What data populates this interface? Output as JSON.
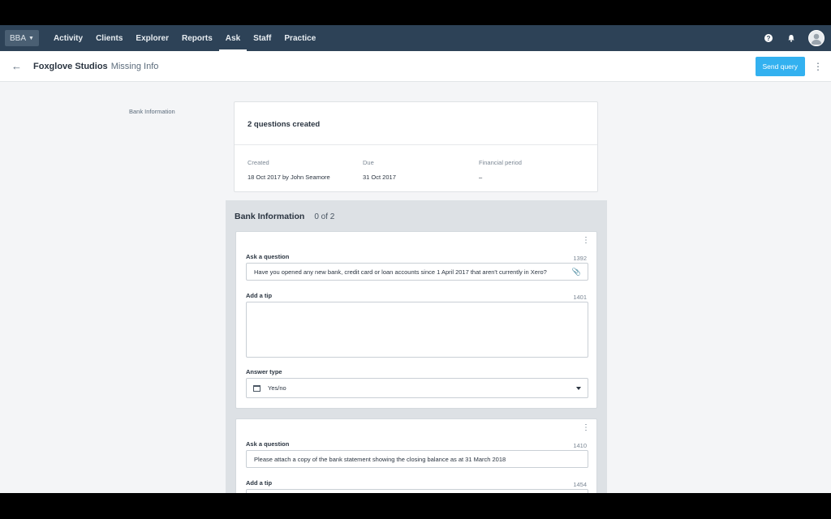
{
  "topnav": {
    "org": "BBA",
    "items": [
      {
        "label": "Activity",
        "active": false
      },
      {
        "label": "Clients",
        "active": false
      },
      {
        "label": "Explorer",
        "active": false
      },
      {
        "label": "Reports",
        "active": false
      },
      {
        "label": "Ask",
        "active": true
      },
      {
        "label": "Staff",
        "active": false
      },
      {
        "label": "Practice",
        "active": false
      }
    ],
    "icons": [
      "help-icon",
      "bell-icon",
      "avatar"
    ]
  },
  "subheader": {
    "client": "Foxglove Studios",
    "page": "Missing Info",
    "send_label": "Send query"
  },
  "section_label": "Bank Information",
  "summary": {
    "title": "2 questions created",
    "created_label": "Created",
    "created_value": "18 Oct 2017 by John Seamore",
    "due_label": "Due",
    "due_value": "31 Oct 2017",
    "period_label": "Financial period",
    "period_value": "–"
  },
  "group": {
    "title": "Bank Information",
    "count": "0 of 2",
    "questions": [
      {
        "ask_label": "Ask a question",
        "ask_count": "1392",
        "ask_value": "Have you opened any new bank, credit card or loan accounts since 1 April 2017 that aren't currently in Xero?",
        "tip_label": "Add a tip",
        "tip_count": "1401",
        "tip_value": "",
        "answer_label": "Answer type",
        "answer_value": "Yes/no"
      },
      {
        "ask_label": "Ask a question",
        "ask_count": "1410",
        "ask_value": "Please attach a copy of the bank statement showing the closing balance as at 31 March 2018",
        "tip_label": "Add a tip",
        "tip_count": "1454"
      }
    ]
  },
  "colors": {
    "nav_bg": "#2d4257",
    "primary_button": "#33b1f0",
    "page_bg": "#f4f5f7"
  }
}
